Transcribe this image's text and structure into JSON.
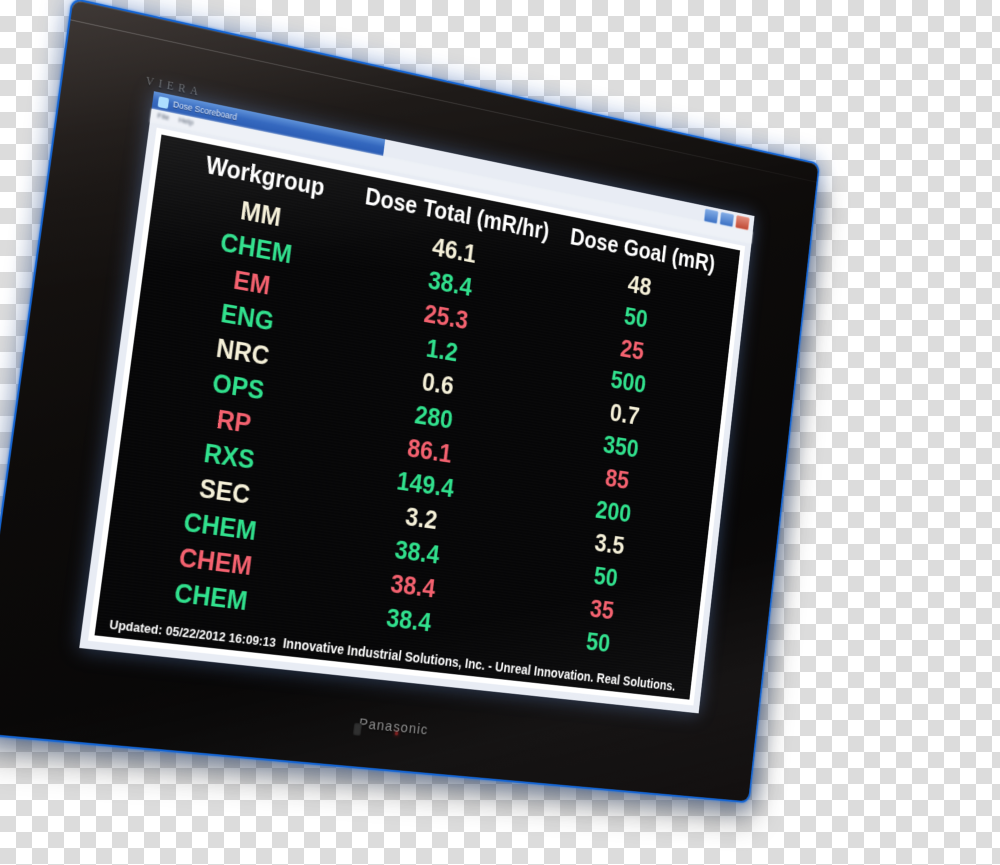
{
  "device": {
    "brand_label": "Panasonic",
    "series_label": "VIERA",
    "bezel_accent_color": "#1464d2"
  },
  "window": {
    "title": "Dose Scoreboard",
    "menu_items": [
      "File",
      "Help"
    ],
    "controls": [
      "minimize-icon",
      "maximize-icon",
      "close-icon"
    ],
    "app_icon": "app-icon"
  },
  "board": {
    "headers": {
      "workgroup": "Workgroup",
      "dose_total": "Dose Total (mR/hr)",
      "dose_goal": "Dose Goal (mR)"
    },
    "colors": {
      "white": "#f5f0d8",
      "green": "#2fe08c",
      "red": "#f4606e",
      "background": "#050506"
    },
    "rows": [
      {
        "workgroup": "MM",
        "dose_total": "46.1",
        "dose_goal": "48",
        "status": "white"
      },
      {
        "workgroup": "CHEM",
        "dose_total": "38.4",
        "dose_goal": "50",
        "status": "green"
      },
      {
        "workgroup": "EM",
        "dose_total": "25.3",
        "dose_goal": "25",
        "status": "red"
      },
      {
        "workgroup": "ENG",
        "dose_total": "1.2",
        "dose_goal": "500",
        "status": "green"
      },
      {
        "workgroup": "NRC",
        "dose_total": "0.6",
        "dose_goal": "0.7",
        "status": "white"
      },
      {
        "workgroup": "OPS",
        "dose_total": "280",
        "dose_goal": "350",
        "status": "green"
      },
      {
        "workgroup": "RP",
        "dose_total": "86.1",
        "dose_goal": "85",
        "status": "red"
      },
      {
        "workgroup": "RXS",
        "dose_total": "149.4",
        "dose_goal": "200",
        "status": "green"
      },
      {
        "workgroup": "SEC",
        "dose_total": "3.2",
        "dose_goal": "3.5",
        "status": "white"
      },
      {
        "workgroup": "CHEM",
        "dose_total": "38.4",
        "dose_goal": "50",
        "status": "green"
      },
      {
        "workgroup": "CHEM",
        "dose_total": "38.4",
        "dose_goal": "35",
        "status": "red"
      },
      {
        "workgroup": "CHEM",
        "dose_total": "38.4",
        "dose_goal": "50",
        "status": "green"
      }
    ]
  },
  "footer": {
    "updated": "Updated: 05/22/2012 16:09:13",
    "tagline": "Innovative Industrial Solutions, Inc. - Unreal Innovation. Real Solutions."
  }
}
